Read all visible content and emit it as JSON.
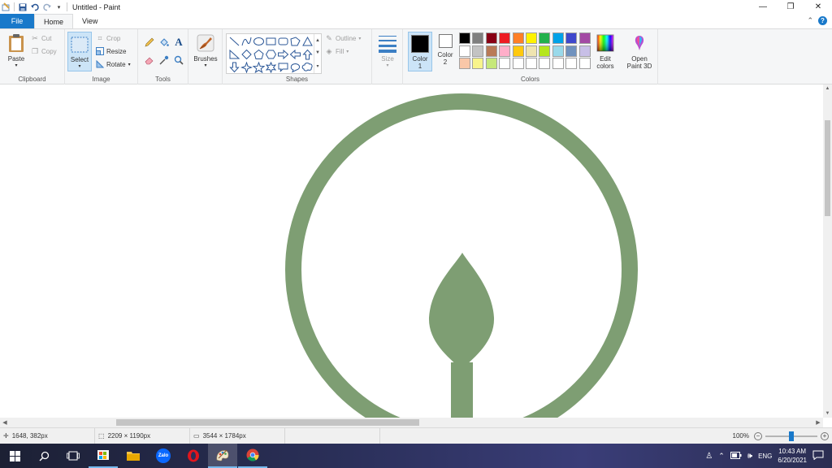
{
  "window": {
    "title": "Untitled - Paint",
    "controls": {
      "minimize": "—",
      "restore": "❐",
      "close": "✕"
    }
  },
  "menu": {
    "tabs": [
      "File",
      "Home",
      "View"
    ],
    "collapse_icon": "chevron-up-icon",
    "help_icon": "?"
  },
  "ribbon": {
    "clipboard": {
      "label": "Clipboard",
      "paste": "Paste",
      "cut": "Cut",
      "copy": "Copy"
    },
    "image": {
      "label": "Image",
      "select": "Select",
      "crop": "Crop",
      "resize": "Resize",
      "rotate": "Rotate"
    },
    "tools": {
      "label": "Tools",
      "items": [
        "pencil-icon",
        "fill-icon",
        "text-icon",
        "eraser-icon",
        "color-picker-icon",
        "magnifier-icon"
      ],
      "text_glyph": "A"
    },
    "brushes": {
      "label": "Brushes"
    },
    "shapes": {
      "label": "Shapes",
      "outline": "Outline",
      "fill": "Fill"
    },
    "size": {
      "label": "Size"
    },
    "colors": {
      "label": "Colors",
      "color1": "Color\n1",
      "color1_line1": "Color",
      "color1_line2": "1",
      "color2_line1": "Color",
      "color2_line2": "2",
      "color1_value": "#000000",
      "color2_value": "#ffffff",
      "palette": [
        "#000000",
        "#7f7f7f",
        "#880015",
        "#ed1c24",
        "#ff7f27",
        "#fff200",
        "#22b14c",
        "#00a2e8",
        "#3f48cc",
        "#a349a4",
        "#ffffff",
        "#c3c3c3",
        "#b97a57",
        "#ffaec9",
        "#ffc90e",
        "#efe4b0",
        "#b5e61d",
        "#99d9ea",
        "#7092be",
        "#c8bfe7",
        "#f9c7a8",
        "#f8f48c",
        "#c6e87a",
        "#ffffff",
        "#ffffff",
        "#ffffff",
        "#ffffff",
        "#ffffff",
        "#ffffff",
        "#ffffff"
      ],
      "edit_line1": "Edit",
      "edit_line2": "colors",
      "paint3d_line1": "Open",
      "paint3d_line2": "Paint 3D"
    }
  },
  "canvas": {
    "drawing_color": "#7e9e73",
    "drawing_description_icon": "leaf-in-circle-drawing"
  },
  "statusbar": {
    "cursor_pos": "1648, 382px",
    "selection_size": "2209 × 1190px",
    "image_size": "3544 × 1784px",
    "zoom": "100%",
    "zoom_level": 0.5
  },
  "taskbar": {
    "apps": [
      "windows-start-icon",
      "search-icon",
      "task-view-icon",
      "store-icon",
      "file-explorer-icon",
      "zalo-icon",
      "opera-icon",
      "paint-icon",
      "chrome-icon"
    ],
    "zalo_text": "Zalo",
    "lang": "ENG",
    "time": "10:43 AM",
    "date": "6/20/2021"
  }
}
